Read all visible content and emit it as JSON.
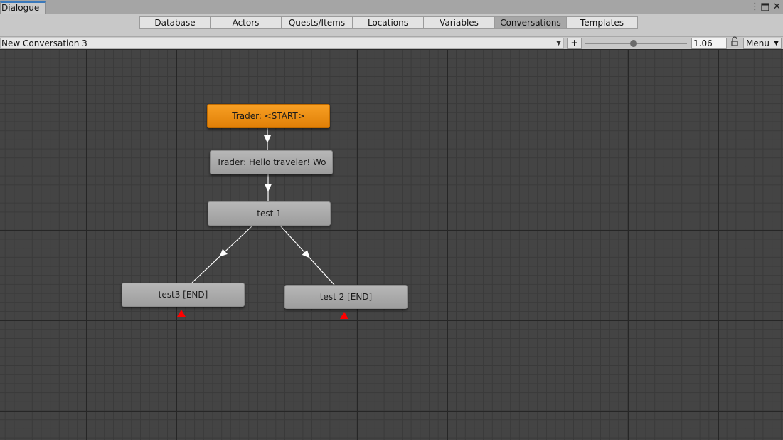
{
  "window": {
    "tab_title": "Dialogue",
    "kebab_glyph": "⋮",
    "maximize_glyph": "🗖",
    "close_glyph": "✕"
  },
  "nav": {
    "tabs": [
      {
        "label": "Database",
        "active": false
      },
      {
        "label": "Actors",
        "active": false
      },
      {
        "label": "Quests/Items",
        "active": false
      },
      {
        "label": "Locations",
        "active": false
      },
      {
        "label": "Variables",
        "active": false
      },
      {
        "label": "Conversations",
        "active": true
      },
      {
        "label": "Templates",
        "active": false
      }
    ]
  },
  "conversation_bar": {
    "selected_conversation": "New Conversation 3",
    "dropdown_glyph": "▼",
    "add_label": "+",
    "zoom_value": "1.06",
    "zoom_slider_fraction": 0.48,
    "menu_label": "Menu",
    "menu_glyph": "▼"
  },
  "graph": {
    "nodes": [
      {
        "id": "start",
        "label": "Trader: <START>",
        "kind": "start"
      },
      {
        "id": "hello",
        "label": "Trader: Hello traveler! Wo",
        "kind": "normal"
      },
      {
        "id": "test1",
        "label": "test 1",
        "kind": "normal"
      },
      {
        "id": "test3",
        "label": "test3 [END]",
        "kind": "end"
      },
      {
        "id": "test2",
        "label": "test 2 [END]",
        "kind": "end"
      }
    ],
    "links": [
      {
        "from": "start",
        "to": "hello"
      },
      {
        "from": "hello",
        "to": "test1"
      },
      {
        "from": "test1",
        "to": "test3"
      },
      {
        "from": "test1",
        "to": "test2"
      }
    ],
    "colors": {
      "start_node": "#f0900f",
      "normal_node": "#a8a8a8",
      "link": "#ffffff",
      "end_marker": "#ff0000",
      "canvas": "#444444"
    }
  }
}
